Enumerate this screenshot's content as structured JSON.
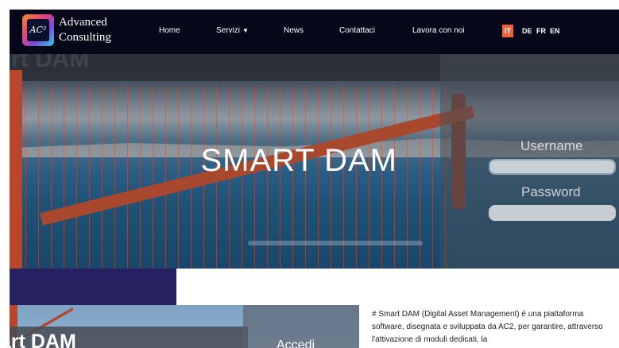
{
  "brand": {
    "logo_mark": "AC²",
    "line1": "Advanced",
    "line2": "Consulting"
  },
  "nav": {
    "items": [
      {
        "label": "Home"
      },
      {
        "label": "Servizi",
        "has_dropdown": true,
        "dropdown_icon": "chevron-down-icon"
      },
      {
        "label": "News"
      },
      {
        "label": "Contattaci"
      },
      {
        "label": "Lavora con noi"
      }
    ],
    "languages": [
      {
        "code": "IT",
        "active": true
      },
      {
        "code": "DE",
        "active": false
      },
      {
        "code": "FR",
        "active": false
      },
      {
        "code": "EN",
        "active": false
      }
    ]
  },
  "hero": {
    "title": "SMART DAM",
    "background_word": "rt DAM",
    "login": {
      "username_label": "Username",
      "password_label": "Password",
      "username_value": "",
      "password_value": ""
    }
  },
  "card": {
    "title": "art DAM",
    "button_label": "Accedi"
  },
  "description": {
    "text": "# Smart DAM (Digital Asset Management) è una piattaforma software, disegnata e sviluppata da AC2, per garantire, attraverso l'attivazione di moduli dedicati, la"
  },
  "colors": {
    "navbar_bg": "#06081a",
    "accent_lang": "#f0623a",
    "navy_block": "#262160",
    "bridge_red": "#b8462c"
  }
}
